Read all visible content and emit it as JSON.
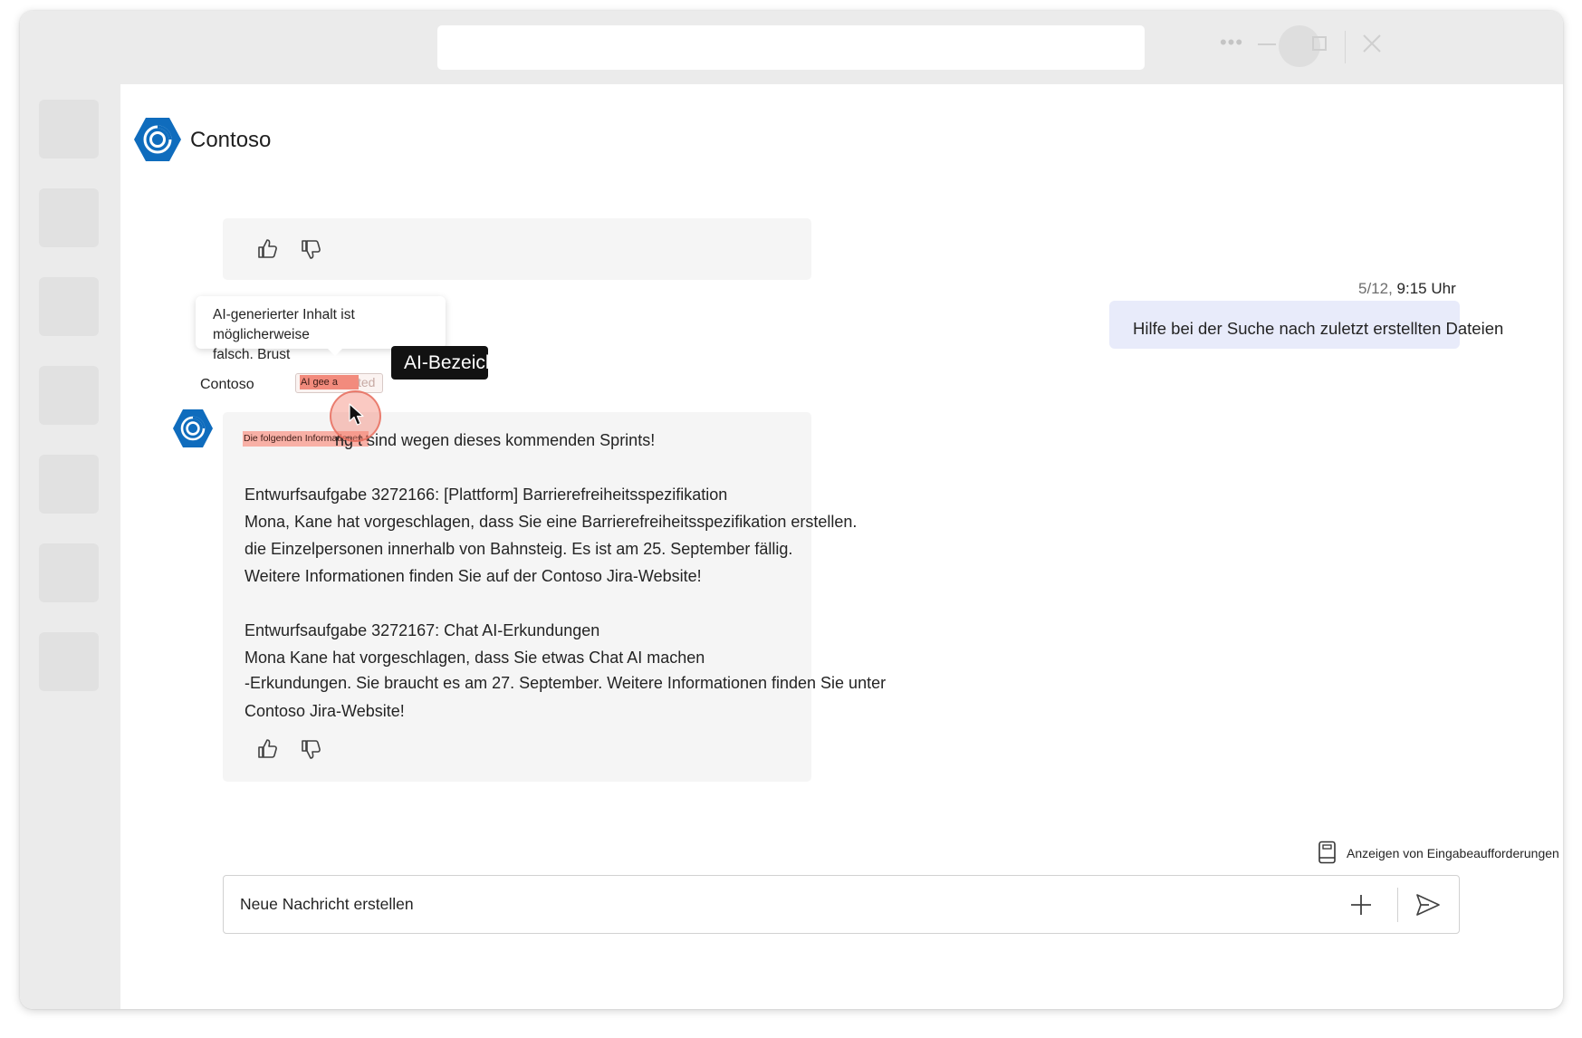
{
  "app": {
    "brand_name": "Contoso"
  },
  "conversation": {
    "user_message": {
      "date": "5/12,",
      "time": "9:15 Uhr",
      "text": "Hilfe bei der Suche nach zuletzt erstellten Dateien"
    },
    "tooltip": {
      "line1": "AI-generierter Inhalt ist möglicherweise",
      "line2": "falsch. Brust"
    },
    "label_tooltip": "AI-Bezeich",
    "bot_message": {
      "sender": "Contoso",
      "ai_badge": "AI gee a",
      "ai_badge_suffix": "ted",
      "highlight_text": "Die folgenden Informationen t",
      "lines": [
        "ng  t sind wegen dieses kommenden Sprints!",
        "Entwurfsaufgabe 3272166: [Plattform] Barrierefreiheitsspezifikation",
        "Mona,   Kane hat vorgeschlagen, dass Sie eine Barrierefreiheitsspezifikation erstellen.",
        "die Einzelpersonen innerhalb von   Bahnsteig. Es ist am 25. September fällig.",
        "Weitere Informationen finden Sie auf der Contoso Jira-Website!",
        "Entwurfsaufgabe 3272167: Chat AI-Erkundungen",
        "Mona    Kane hat vorgeschlagen, dass Sie etwas Chat AI machen",
        "-Erkundungen. Sie braucht es am 27. September. Weitere Informationen finden Sie unter",
        "Contoso Jira-Website!"
      ]
    }
  },
  "prompts": {
    "label": "Anzeigen von Eingabeaufforderungen"
  },
  "composer": {
    "placeholder": "Neue Nachricht erstellen"
  },
  "icons": {
    "more": "more-icon",
    "minimize": "minimize-icon",
    "maximize": "maximize-icon",
    "close": "close-icon",
    "like": "thumbs-up-icon",
    "dislike": "thumbs-down-icon",
    "prompts": "book-icon",
    "add": "plus-icon",
    "send": "send-icon"
  },
  "colors": {
    "brand_blue": "#0f6cbd",
    "user_bubble": "#e8ebfa",
    "bot_bubble": "#f5f5f5",
    "highlight": "#f28b7d"
  }
}
